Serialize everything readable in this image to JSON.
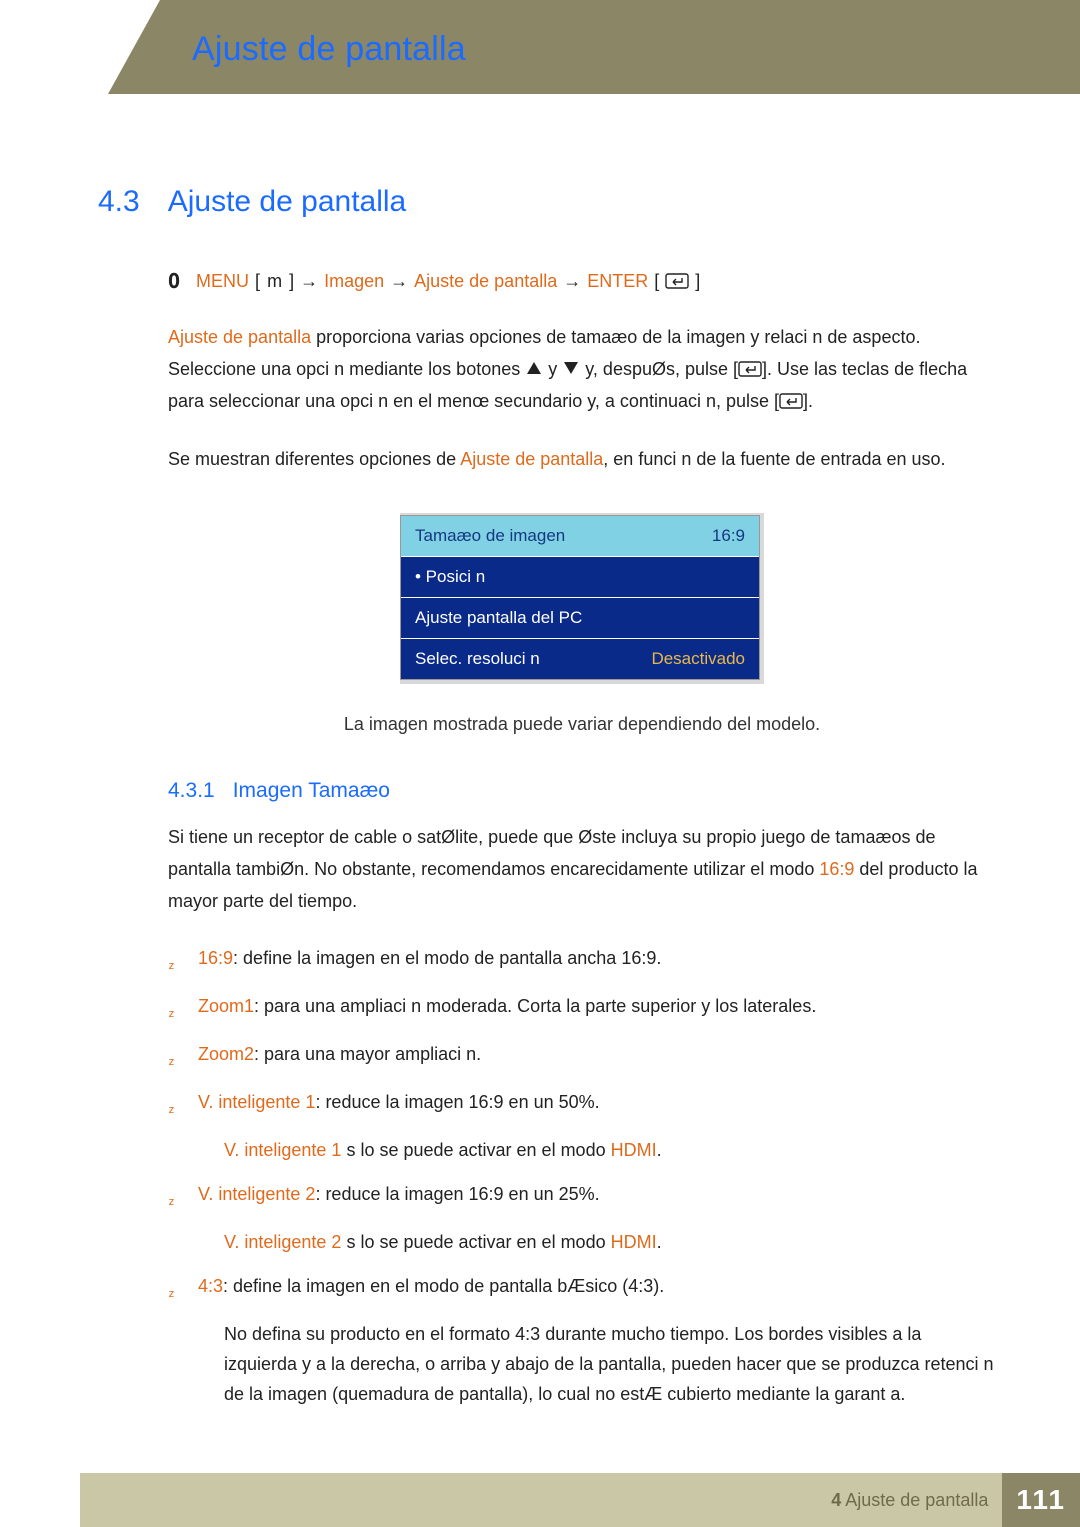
{
  "header": {
    "title": "Ajuste de pantalla"
  },
  "section": {
    "number": "4.3",
    "title": "Ajuste de pantalla"
  },
  "nav": {
    "menu": "MENU",
    "m": "m",
    "arrow": "→",
    "imagen": "Imagen",
    "ajuste": "Ajuste de pantalla",
    "enter": "ENTER"
  },
  "para1": {
    "lead": "Ajuste de pantalla",
    "p1a": " proporciona varias opciones de tamaæo de la imagen y relaci n de aspecto. Seleccione una opci n mediante los botones ",
    "p1b": " y ",
    "p1c": " y, despuØs, pulse [",
    "p1d": "]. Use las teclas de flecha para seleccionar una opci n en el menœ secundario y, a continuaci n, pulse [",
    "p1e": "]."
  },
  "para2": {
    "a": "Se muestran diferentes opciones de ",
    "b": "Ajuste de pantalla",
    "c": ", en funci n de la fuente de entrada en uso."
  },
  "menu": {
    "items": [
      {
        "label": "Tamaæo de imagen",
        "value": "16:9",
        "selected": true
      },
      {
        "label": "• Posici n",
        "value": "",
        "selected": false
      },
      {
        "label": "Ajuste pantalla del PC",
        "value": "",
        "selected": false
      },
      {
        "label": "Selec. resoluci n",
        "value": "Desactivado",
        "selected": false
      }
    ]
  },
  "caption": "La imagen mostrada puede variar dependiendo del modelo.",
  "subsection": {
    "number": "4.3.1",
    "title": "Imagen Tamaæo"
  },
  "intro": {
    "a": "Si tiene un receptor de cable o satØlite, puede que Øste incluya su propio juego de tamaæos de pantalla tambiØn. No obstante, recomendamos encarecidamente utilizar el modo ",
    "b": "16:9",
    "c": " del producto la mayor parte del tiempo."
  },
  "bullets": {
    "b1": {
      "k": "16:9",
      "t": ": define la imagen en el modo de pantalla ancha 16:9."
    },
    "b2": {
      "k": "Zoom1",
      "t": ": para una ampliaci n moderada. Corta la parte superior y los laterales."
    },
    "b3": {
      "k": "Zoom2",
      "t": ": para una mayor ampliaci n."
    },
    "b4": {
      "k": "V. inteligente 1",
      "t": ": reduce la imagen 16:9 en un 50%."
    },
    "n4": {
      "k": "V. inteligente 1",
      "mid": " s lo se puede activar en el modo ",
      "m": "HDMI",
      "end": "."
    },
    "b5": {
      "k": "V. inteligente 2",
      "t": ": reduce la imagen 16:9 en un 25%."
    },
    "n5": {
      "k": "V. inteligente 2",
      "mid": " s lo se puede activar en el modo ",
      "m": "HDMI",
      "end": "."
    },
    "b6": {
      "k": "4:3",
      "t": ": define la imagen en el modo de pantalla bÆsico (4:3)."
    },
    "warn": "No defina su producto en el formato 4:3 durante mucho tiempo. Los bordes visibles a la izquierda y a la derecha, o arriba y abajo de la pantalla, pueden hacer que se produzca retenci n de la imagen (quemadura de pantalla), lo cual no estÆ cubierto mediante la garant a."
  },
  "footer": {
    "crumb_num": "4",
    "crumb_text": " Ajuste de pantalla",
    "page": "111"
  }
}
